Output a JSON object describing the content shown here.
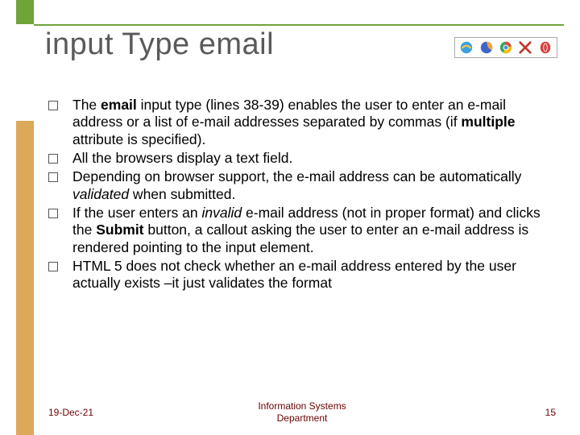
{
  "title": "input Type email",
  "browsers": [
    "ie-icon",
    "firefox-icon",
    "chrome-icon",
    "safari-x-icon",
    "opera-icon"
  ],
  "bullets": [
    {
      "html": "The <b>email</b> input type (lines 38-39) enables the user to enter an e-mail address or a list of e-mail addresses separated by commas (if <b>multiple</b> attribute is specified)."
    },
    {
      "html": "All the browsers display a text field."
    },
    {
      "html": "Depending on browser support, the e-mail address can be automatically <i>validated</i> when submitted."
    },
    {
      "html": "If the user enters an <i>invalid</i> e-mail address (not in proper format) and clicks the <b>Submit</b> button, a callout asking the user to enter an e-mail address is rendered pointing to the input element."
    },
    {
      "html": "HTML 5 does not check whether an e-mail address entered by the user actually exists –it just validates the format"
    }
  ],
  "footer": {
    "date": "19-Dec-21",
    "center_line1": "Information Systems",
    "center_line2": "Department",
    "page": "15"
  }
}
